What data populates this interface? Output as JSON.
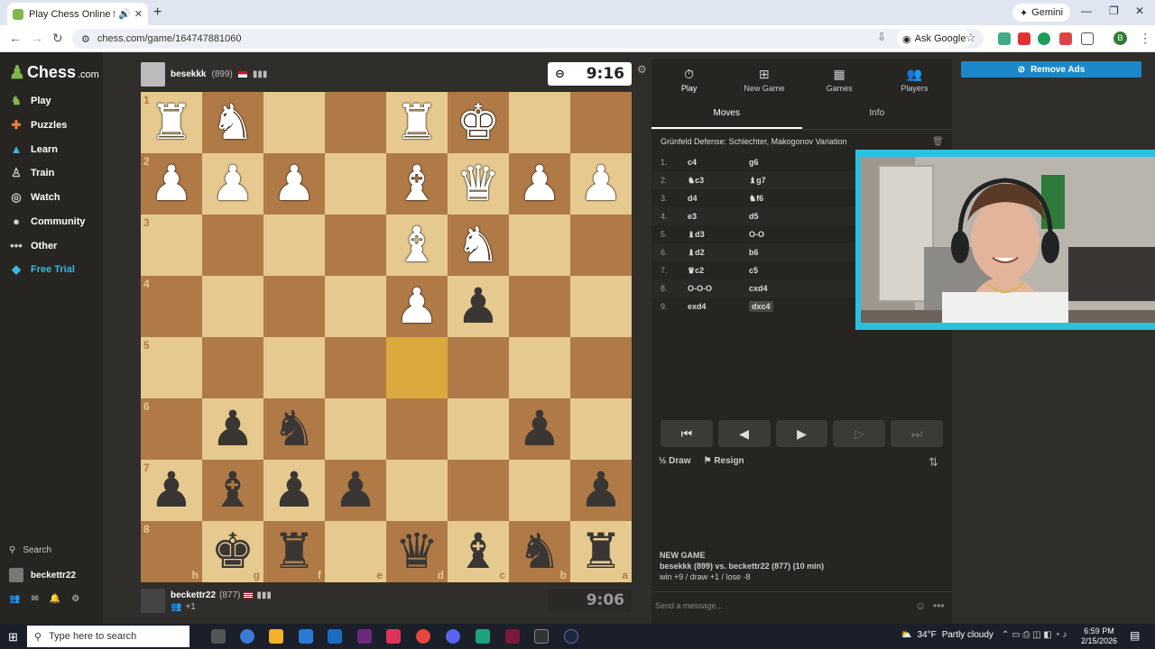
{
  "browser": {
    "tab_title": "Play Chess Online for FREE",
    "url": "chess.com/game/164747881060",
    "gemini_label": "Gemini",
    "ask_google_label": "Ask Google",
    "profile_initial": "B"
  },
  "sidebar": {
    "logo": "Chess",
    "logo_suffix": ".com",
    "items": [
      {
        "label": "Play",
        "icon": "play-icon",
        "color": "#81b64c"
      },
      {
        "label": "Puzzles",
        "icon": "puzzle-icon",
        "color": "#f27e3a"
      },
      {
        "label": "Learn",
        "icon": "learn-icon",
        "color": "#3cb6e0"
      },
      {
        "label": "Train",
        "icon": "train-icon",
        "color": "#cccccc"
      },
      {
        "label": "Watch",
        "icon": "watch-icon",
        "color": "#cccccc"
      },
      {
        "label": "Community",
        "icon": "community-icon",
        "color": "#cccccc"
      },
      {
        "label": "Other",
        "icon": "more-icon",
        "color": "#cccccc"
      },
      {
        "label": "Free Trial",
        "icon": "diamond-icon",
        "color": "#3cb6e0"
      }
    ],
    "search_label": "Search",
    "username": "beckettr22"
  },
  "top_player": {
    "name": "besekkk",
    "rating": "(899)",
    "clock": "9:16"
  },
  "bottom_player": {
    "name": "beckettr22",
    "rating": "(877)",
    "friends": "+1",
    "clock": "9:06"
  },
  "board": {
    "files": [
      "h",
      "g",
      "f",
      "e",
      "d",
      "c",
      "b",
      "a"
    ],
    "ranks": [
      "1",
      "2",
      "3",
      "4",
      "5",
      "6",
      "7",
      "8"
    ],
    "highlight": "d5",
    "rows": [
      [
        "wR",
        "wN",
        "",
        "",
        "wR",
        "wK",
        "",
        ""
      ],
      [
        "wP",
        "wP",
        "wP",
        "",
        "wB",
        "wQ",
        "wP",
        "wP"
      ],
      [
        "",
        "",
        "",
        "",
        "wB",
        "wN",
        "",
        ""
      ],
      [
        "",
        "",
        "",
        "",
        "wP",
        "bP",
        "",
        ""
      ],
      [
        "",
        "",
        "",
        "",
        "",
        "",
        "",
        ""
      ],
      [
        "",
        "bP",
        "bN",
        "",
        "",
        "",
        "bP",
        ""
      ],
      [
        "bP",
        "bB",
        "bP",
        "bP",
        "",
        "",
        "",
        "bP"
      ],
      [
        "",
        "bK",
        "bR",
        "",
        "bQ",
        "bB",
        "bN",
        "bR"
      ]
    ]
  },
  "panel": {
    "tabs": [
      {
        "label": "Play",
        "icon": "clock-icon"
      },
      {
        "label": "New Game",
        "icon": "plus-icon"
      },
      {
        "label": "Games",
        "icon": "board-icon"
      },
      {
        "label": "Players",
        "icon": "players-icon"
      }
    ],
    "subtabs": [
      "Moves",
      "Info"
    ],
    "opening": "Grünfeld Defense: Schlechter, Makogonov Variation",
    "moves": [
      {
        "n": "1.",
        "w": "c4",
        "b": "g6"
      },
      {
        "n": "2.",
        "w": "♞c3",
        "b": "♝g7"
      },
      {
        "n": "3.",
        "w": "d4",
        "b": "♞f6"
      },
      {
        "n": "4.",
        "w": "e3",
        "b": "d5"
      },
      {
        "n": "5.",
        "w": "♝d3",
        "b": "O-O"
      },
      {
        "n": "6.",
        "w": "♝d2",
        "b": "b6"
      },
      {
        "n": "7.",
        "w": "♛c2",
        "b": "c5"
      },
      {
        "n": "8.",
        "w": "O-O-O",
        "b": "cxd4"
      },
      {
        "n": "9.",
        "w": "exd4",
        "b": "dxc4"
      }
    ],
    "draw_label": "Draw",
    "resign_label": "Resign",
    "new_game_heading": "NEW GAME",
    "game_summary": "besekkk (899) vs. beckettr22 (877) (10 min)",
    "game_stakes": "win +9 / draw +1 / lose -8",
    "chat_placeholder": "Send a message..."
  },
  "remove_ads_label": "Remove Ads",
  "taskbar": {
    "search_placeholder": "Type here to search",
    "temperature": "34°F",
    "weather": "Partly cloudy",
    "time": "6:59 PM",
    "date": "2/15/2026"
  }
}
